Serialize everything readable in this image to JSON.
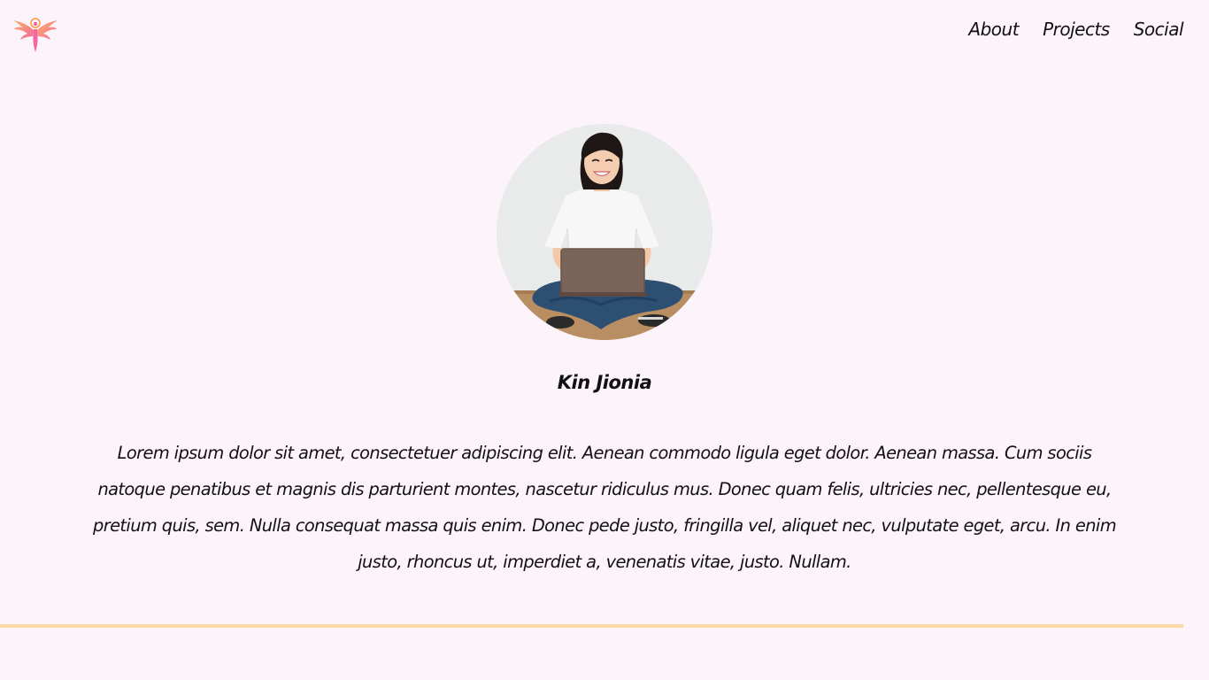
{
  "nav": {
    "items": [
      {
        "label": "About"
      },
      {
        "label": "Projects"
      },
      {
        "label": "Social"
      }
    ]
  },
  "profile": {
    "name": "Kin Jionia",
    "bio": "Lorem ipsum dolor sit amet, consectetuer adipiscing elit. Aenean commodo ligula eget dolor. Aenean massa. Cum sociis natoque penatibus et magnis dis parturient montes, nascetur ridiculus mus. Donec quam felis, ultricies nec, pellentesque eu, pretium quis, sem. Nulla consequat massa quis enim. Donec pede justo, fringilla vel, aliquet nec, vulputate eget, arcu. In enim justo, rhoncus ut, imperdiet a, venenatis vitae, justo. Nullam."
  },
  "icons": {
    "logo": "phoenix-logo-icon",
    "avatar": "profile-photo"
  },
  "colors": {
    "background": "#fdf3fb",
    "divider": "#ffd7a6",
    "logo_orange": "#ff9a4d",
    "logo_pink": "#f0689e"
  }
}
